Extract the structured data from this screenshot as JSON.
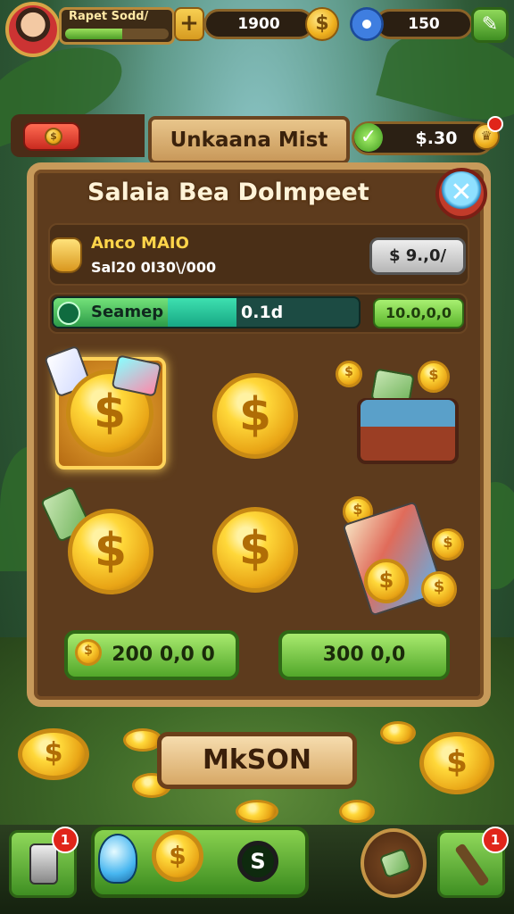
{
  "player": {
    "name": "Rapet Sodd/",
    "xp_progress": 0.55
  },
  "hud": {
    "currency1": "1900",
    "currency2": "150",
    "plus_label": "+"
  },
  "banner": {
    "title": "Unkaana Mist",
    "money": "$.30"
  },
  "panel": {
    "title": "Salaia Bea Dolmpeet",
    "item_name": "Anco MAIO",
    "item_sub": "Sal20 0I30\\/000",
    "price_label": "$ 9.,0/",
    "progress_label": "Seamep",
    "progress_value": "0.1d",
    "progress_fraction": 0.6,
    "progress_right": "10.0,0,0",
    "coin_symbol": "$",
    "buy_left_label": "200 0,0 0",
    "buy_right_label": "300 0,0"
  },
  "action_button": "MkSON",
  "close_symbol": "✕",
  "bottom": {
    "badge_left": "1",
    "badge_right": "1",
    "dollar": "S"
  },
  "colors": {
    "accent_green": "#52a72a",
    "panel_brown": "#5d3b1d",
    "gold": "#f0b21f"
  }
}
